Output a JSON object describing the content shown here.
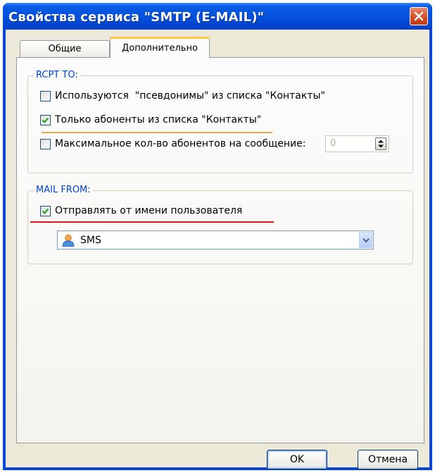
{
  "window": {
    "title": "Свойства сервиса \"SMTP (E-MAIL)\""
  },
  "tabs": [
    {
      "label": "Общие",
      "selected": false
    },
    {
      "label": "Дополнительно",
      "selected": true
    }
  ],
  "rcpt_to": {
    "legend": "RCPT TO:",
    "options": [
      {
        "label": "Используются  \"псевдонимы\" из списка \"Контакты\"",
        "checked": false
      },
      {
        "label": "Только абоненты из списка \"Контакты\"",
        "checked": true
      },
      {
        "label": "Максимальное кол-во абонентов на сообщение:",
        "checked": false
      }
    ],
    "max_value": "0"
  },
  "mail_from": {
    "legend": "MAIL FROM:",
    "send_as_user_label": "Отправлять от имени пользователя",
    "send_as_user_checked": true,
    "selected_user": "SMS",
    "user_icon": "user-icon"
  },
  "buttons": {
    "ok": "OK",
    "cancel": "Отмена"
  },
  "colors": {
    "title_bar": "#0553de",
    "legend_text": "#0046d5",
    "orange_underline": "#f0a54a",
    "red_underline": "#e0151a",
    "check_mark": "#21a121"
  }
}
